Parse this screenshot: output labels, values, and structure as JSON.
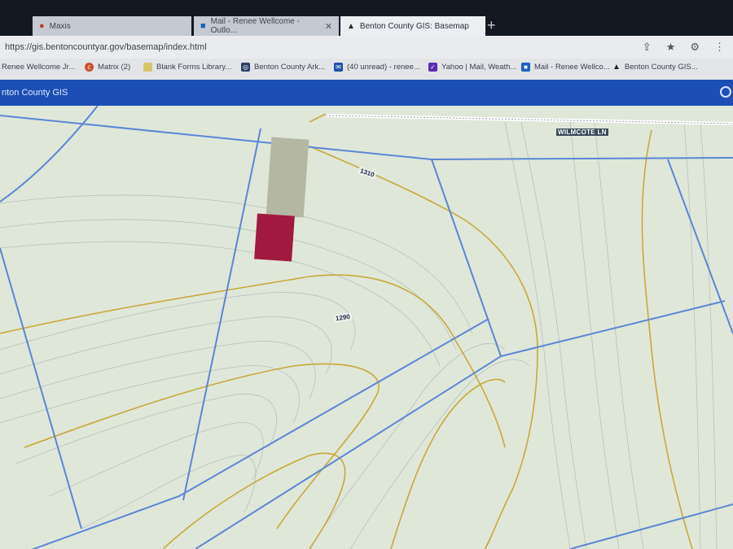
{
  "browser": {
    "tabs": [
      {
        "label": "Maxis",
        "icon": "chrome-icon",
        "active": false
      },
      {
        "label": "Mail - Renee Wellcome - Outlo...",
        "icon": "outlook-icon",
        "active": false
      },
      {
        "label": "Benton County GIS: Basemap",
        "icon": "esri-icon",
        "active": true
      }
    ],
    "new_tab_glyph": "+",
    "url": "https://gis.bentoncountyar.gov/basemap/index.html",
    "bookmarks": [
      {
        "label": "Renee Wellcome Jr...",
        "icon": "bookmark-icon"
      },
      {
        "label": "Matrix (2)",
        "icon": "matrix-icon"
      },
      {
        "label": "Blank Forms Library...",
        "icon": "document-icon"
      },
      {
        "label": "Benton County Ark...",
        "icon": "county-icon"
      },
      {
        "label": "(40 unread) - renee...",
        "icon": "mail-icon"
      },
      {
        "label": "Yahoo | Mail, Weath...",
        "icon": "yahoo-icon"
      },
      {
        "label": "Mail - Renee Wellco...",
        "icon": "outlook-icon"
      },
      {
        "label": "Benton County GIS...",
        "icon": "esri-icon"
      }
    ]
  },
  "app": {
    "title": "nton County GIS"
  },
  "map": {
    "road_label": "WILMCOTE LN",
    "contour_labels": [
      "1310",
      "1290"
    ],
    "colors": {
      "background": "#dfe7d9",
      "parcel_line": "#5b86d4",
      "contour_major": "#c9a83a",
      "contour_minor": "#a9b8b8",
      "parcel_highlight": "#a0193f",
      "parcel_building": "#b4b7a2"
    }
  }
}
